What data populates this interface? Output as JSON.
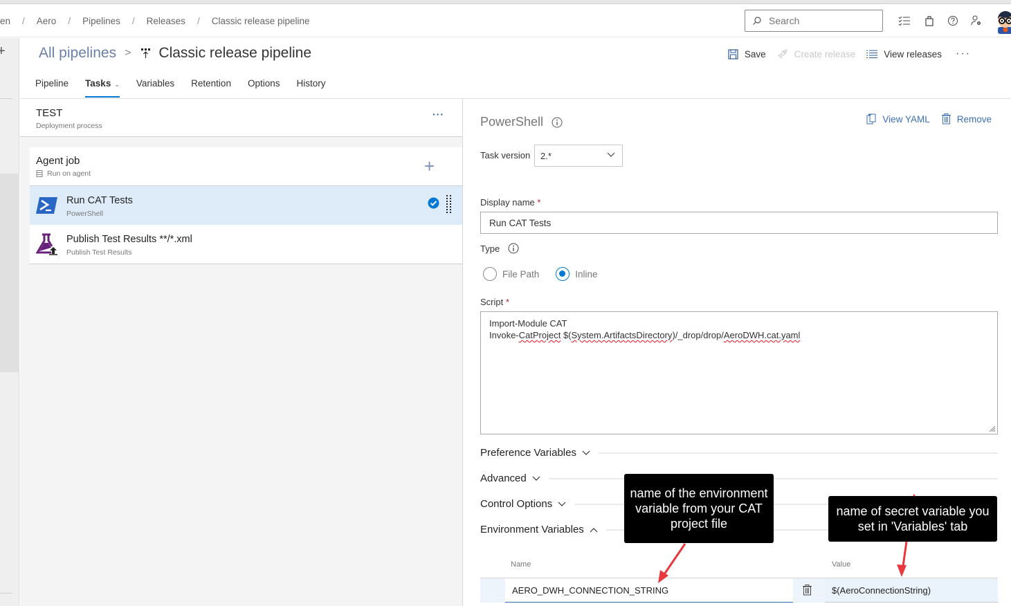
{
  "breadcrumb": {
    "items": [
      "en",
      "Aero",
      "Pipelines",
      "Releases",
      "Classic release pipeline"
    ],
    "separator": "/"
  },
  "header": {
    "search_placeholder": "Search",
    "icons": [
      "work-items-icon",
      "marketplace-bag-icon",
      "help-icon",
      "user-settings-icon",
      "avatar"
    ]
  },
  "title": {
    "parent_link": "All pipelines",
    "chevron": ">",
    "page_title": "Classic release pipeline",
    "actions": {
      "save": "Save",
      "create_release": "Create release",
      "view_releases": "View releases",
      "more": "···"
    }
  },
  "tabs": [
    {
      "label": "Pipeline",
      "active": false
    },
    {
      "label": "Tasks",
      "active": true,
      "has_dropdown": true
    },
    {
      "label": "Variables",
      "active": false
    },
    {
      "label": "Retention",
      "active": false
    },
    {
      "label": "Options",
      "active": false
    },
    {
      "label": "History",
      "active": false
    }
  ],
  "stage": {
    "name": "TEST",
    "subtitle": "Deployment process",
    "more": "···"
  },
  "job": {
    "name": "Agent job",
    "subtitle": "Run on agent",
    "add": "+"
  },
  "tasks": [
    {
      "name": "Run CAT Tests",
      "type": "PowerShell",
      "selected": true,
      "icon": "powershell-icon"
    },
    {
      "name": "Publish Test Results **/*.xml",
      "type": "Publish Test Results",
      "selected": false,
      "icon": "publish-test-results-icon"
    }
  ],
  "detail": {
    "task_title": "PowerShell",
    "view_yaml": "View YAML",
    "remove": "Remove",
    "task_version_label": "Task version",
    "task_version_value": "2.*",
    "display_name_label": "Display name",
    "required_mark": "*",
    "display_name_value": "Run CAT Tests",
    "type_label": "Type",
    "type_options": [
      {
        "label": "File Path",
        "checked": false
      },
      {
        "label": "Inline",
        "checked": true
      }
    ],
    "script_label": "Script",
    "script_lines": {
      "line1": "Import-Module CAT",
      "line2_a": "Invoke-",
      "line2_b": "CatProject",
      "line2_c": " $(",
      "line2_d": "System.ArtifactsDirectory",
      "line2_e": ")/_drop/drop/",
      "line2_f": "AeroDWH.cat.yaml"
    },
    "sections": [
      {
        "label": "Preference Variables",
        "expanded": false
      },
      {
        "label": "Advanced",
        "expanded": false
      },
      {
        "label": "Control Options",
        "expanded": false
      },
      {
        "label": "Environment Variables",
        "expanded": true
      }
    ],
    "env_vars": {
      "name_header": "Name",
      "value_header": "Value",
      "rows": [
        {
          "name": "AERO_DWH_CONNECTION_STRING",
          "value": "$(AeroConnectionString)"
        }
      ]
    }
  },
  "annotations": {
    "callout_1": "name of the environment variable from your CAT project file",
    "callout_2": "name of secret variable you set in 'Variables' tab",
    "arrow_color": "#e8383d"
  },
  "colors": {
    "accent": "#0078d4",
    "link": "#3b6fb6",
    "selected_row": "#deecf9",
    "powershell": "#2a67c4",
    "test_results": "#68217a"
  }
}
